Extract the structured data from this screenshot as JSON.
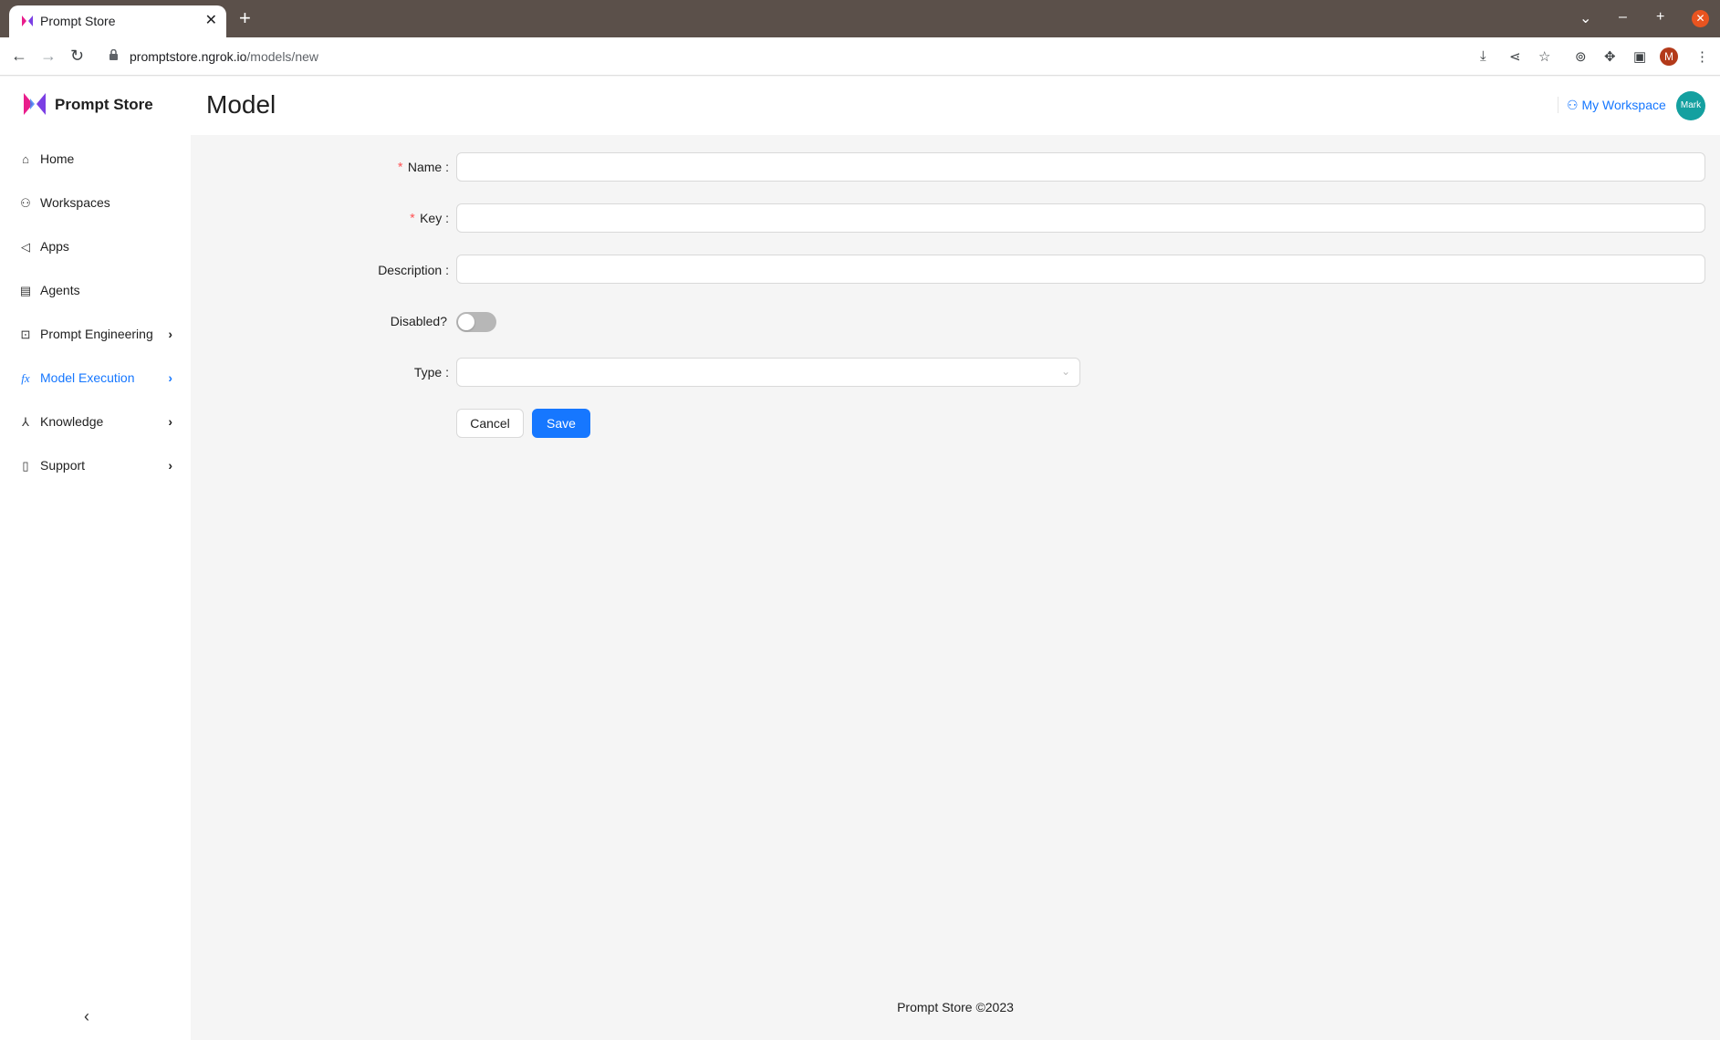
{
  "browser": {
    "tab_title": "Prompt Store",
    "url_host": "promptstore.ngrok.io",
    "url_path": "/models/new",
    "profile_initial": "M"
  },
  "app": {
    "brand": "Prompt Store",
    "page_title": "Model",
    "workspace_link": "My Workspace",
    "avatar_text": "Mark",
    "footer": "Prompt Store ©2023"
  },
  "sidebar": {
    "items": [
      {
        "label": "Home",
        "icon": "home-icon"
      },
      {
        "label": "Workspaces",
        "icon": "workspaces-icon"
      },
      {
        "label": "Apps",
        "icon": "megaphone-icon"
      },
      {
        "label": "Agents",
        "icon": "agent-icon"
      },
      {
        "label": "Prompt Engineering",
        "icon": "code-icon",
        "expandable": true
      },
      {
        "label": "Model Execution",
        "icon": "function-icon",
        "expandable": true,
        "active": true
      },
      {
        "label": "Knowledge",
        "icon": "network-icon",
        "expandable": true
      },
      {
        "label": "Support",
        "icon": "book-icon",
        "expandable": true
      }
    ]
  },
  "form": {
    "name_label": "Name",
    "key_label": "Key",
    "description_label": "Description",
    "disabled_label": "Disabled?",
    "type_label": "Type",
    "cancel_label": "Cancel",
    "save_label": "Save",
    "disabled_value": false
  },
  "colors": {
    "accent": "#1677ff",
    "required": "#ff4d4f",
    "avatar_bg": "#14a0a0"
  }
}
